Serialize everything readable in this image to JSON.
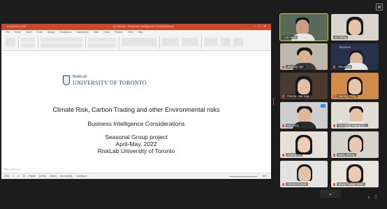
{
  "shared_screen": {
    "ppt_title": "Q-Climate - Business Intelligence Considerations",
    "ppt_left": "AutoSave  ● Off",
    "ribbon_tabs": "File Home Insert Draw Design Transitions Animations Slide Show Review View Help",
    "slide": {
      "logo_top": "RiskLab",
      "logo_bottom": "UNIVERSITY OF TORONTO",
      "title": "Climate Risk, Carbon Trading and other Environmental risks",
      "subtitle": "Business Intelligence Considerations",
      "line3": "Seasonal Group project",
      "line4": "April-May, 2022",
      "line5": "RiskLab University of Toronto"
    },
    "notes_placeholder": "Click to add notes",
    "status_left": "Slide 1 of 16 English (United States) Accessibility: Investigate",
    "status_right": "68%"
  },
  "participants": [
    {
      "name": "Luis Seco",
      "active": true
    },
    {
      "name": "Ivy Wang"
    },
    {
      "name": "Jingxinyi Qin"
    },
    {
      "name": "HeLHU LI"
    },
    {
      "name": "Franny- Hai Yujia"
    },
    {
      "name": "Huirong Peng"
    },
    {
      "name": "Kai Zong"
    },
    {
      "name": "Yuncheng Huang  (Z..."
    },
    {
      "name": "Xiyang Liu"
    },
    {
      "name": "Daisy Zheng"
    },
    {
      "name": "YIFAN ZHANG"
    },
    {
      "name": "Wang Yuying Helen"
    }
  ],
  "controls": {
    "chevron": "⌄"
  }
}
